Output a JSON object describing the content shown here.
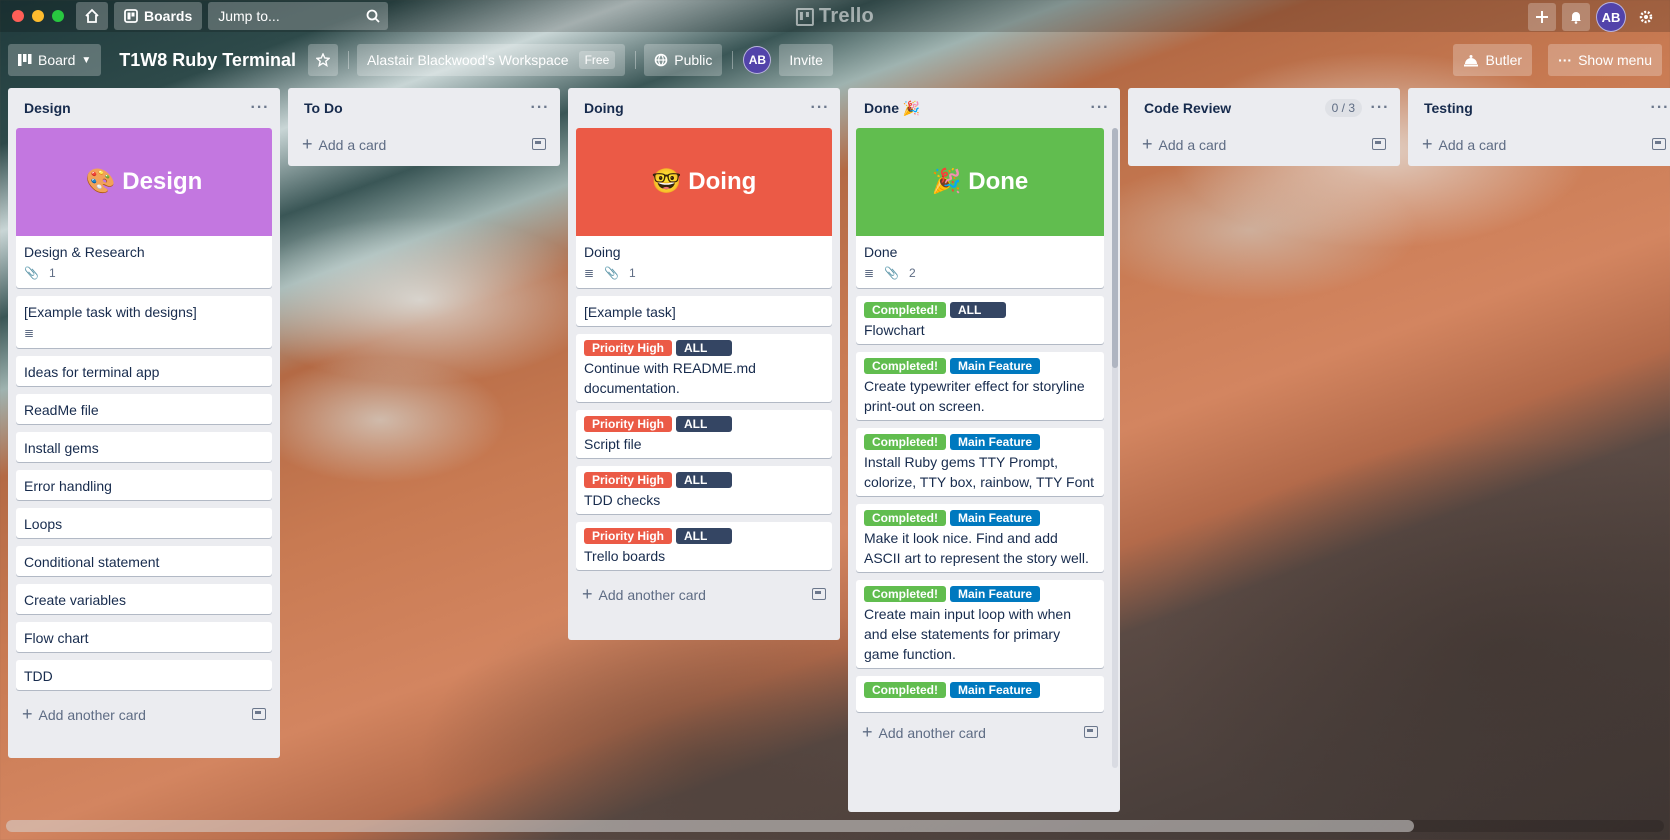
{
  "titlebar": {
    "boards_label": "Boards",
    "jump_placeholder": "Jump to...",
    "logo_text": "Trello",
    "avatar_initials": "AB"
  },
  "boardbar": {
    "view_label": "Board",
    "board_title": "T1W8 Ruby Terminal",
    "workspace_label": "Alastair Blackwood's Workspace",
    "free_badge": "Free",
    "visibility_label": "Public",
    "member_initials": "AB",
    "invite_label": "Invite",
    "butler_label": "Butler",
    "show_menu_label": "Show menu"
  },
  "lists": [
    {
      "title": "Design",
      "add_label": "Add another card",
      "cover": {
        "text": "🎨 Design",
        "color": "#c377e0",
        "title": "Design & Research",
        "attachments": "1"
      },
      "cards": [
        {
          "title": "[Example task with designs]",
          "has_description": true
        },
        {
          "title": "Ideas for terminal app"
        },
        {
          "title": "ReadMe file"
        },
        {
          "title": "Install gems"
        },
        {
          "title": "Error handling"
        },
        {
          "title": "Loops"
        },
        {
          "title": "Conditional statement"
        },
        {
          "title": "Create variables"
        },
        {
          "title": "Flow chart"
        },
        {
          "title": "TDD"
        }
      ]
    },
    {
      "title": "To Do",
      "add_label": "Add a card"
    },
    {
      "title": "Doing",
      "add_label": "Add another card",
      "cover": {
        "text": "🤓 Doing",
        "color": "#eb5a46",
        "title": "Doing",
        "attachments": "1"
      },
      "cards": [
        {
          "title": "[Example task]"
        },
        {
          "title": "Continue with README.md documentation.",
          "labels": [
            "Priority High",
            "ALL"
          ]
        },
        {
          "title": "Script file",
          "labels": [
            "Priority High",
            "ALL"
          ]
        },
        {
          "title": "TDD checks",
          "labels": [
            "Priority High",
            "ALL"
          ]
        },
        {
          "title": "Trello boards",
          "labels": [
            "Priority High",
            "ALL"
          ]
        }
      ]
    },
    {
      "title": "Done 🎉",
      "add_label": "Add another card",
      "cover": {
        "text": "🎉 Done",
        "color": "#61bd4f",
        "title": "Done",
        "attachments": "2"
      },
      "cards": [
        {
          "title": "Flowchart",
          "labels": [
            "Completed!",
            "ALL"
          ]
        },
        {
          "title": "Create typewriter effect for storyline print-out on screen.",
          "labels": [
            "Completed!",
            "Main Feature"
          ]
        },
        {
          "title": "Install Ruby gems TTY Prompt, colorize, TTY box, rainbow, TTY Font",
          "labels": [
            "Completed!",
            "Main Feature"
          ]
        },
        {
          "title": "Make it look nice. Find and add ASCII art to represent the story well.",
          "labels": [
            "Completed!",
            "Main Feature"
          ]
        },
        {
          "title": "Create main input loop with when and else statements for primary game function.",
          "labels": [
            "Completed!",
            "Main Feature"
          ]
        },
        {
          "title": "",
          "labels": [
            "Completed!",
            "Main Feature"
          ]
        }
      ]
    },
    {
      "title": "Code Review",
      "count": "0 / 3",
      "add_label": "Add a card"
    },
    {
      "title": "Testing",
      "add_label": "Add a card"
    }
  ],
  "label_colors": {
    "Priority High": "#eb5a46",
    "ALL": "#344563",
    "Completed!": "#61bd4f",
    "Main Feature": "#0079bf"
  },
  "icons": [
    "home-icon",
    "boards-icon",
    "search-icon",
    "plus-icon",
    "bell-icon",
    "settings-icon",
    "star-icon",
    "globe-icon",
    "butler-icon",
    "more-icon",
    "attachment-icon",
    "description-icon",
    "template-icon"
  ]
}
